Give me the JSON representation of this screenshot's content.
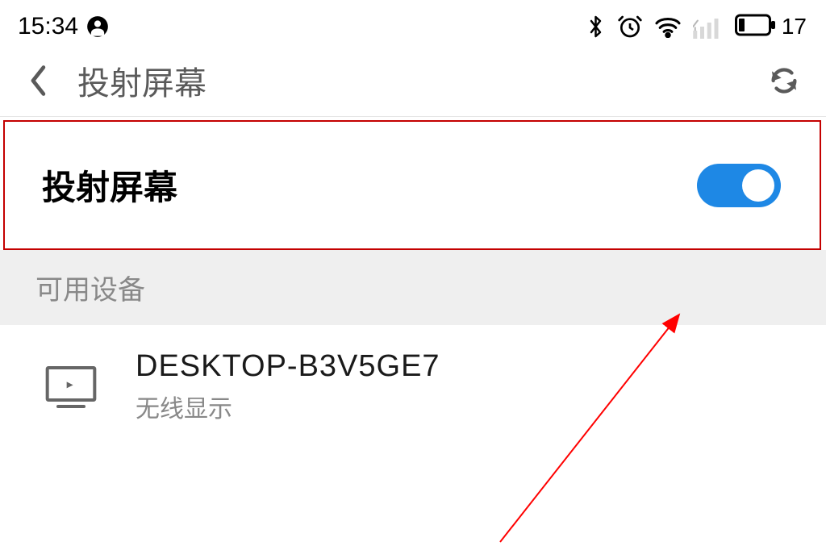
{
  "status_bar": {
    "time": "15:34",
    "battery_level": "17"
  },
  "header": {
    "title": "投射屏幕"
  },
  "cast_toggle": {
    "label": "投射屏幕",
    "enabled": true
  },
  "section": {
    "title": "可用设备"
  },
  "device": {
    "name": "DESKTOP-B3V5GE7",
    "subtitle": "无线显示"
  },
  "colors": {
    "accent": "#1e88e5",
    "highlight_border": "#c40000",
    "arrow": "#ff0000"
  }
}
